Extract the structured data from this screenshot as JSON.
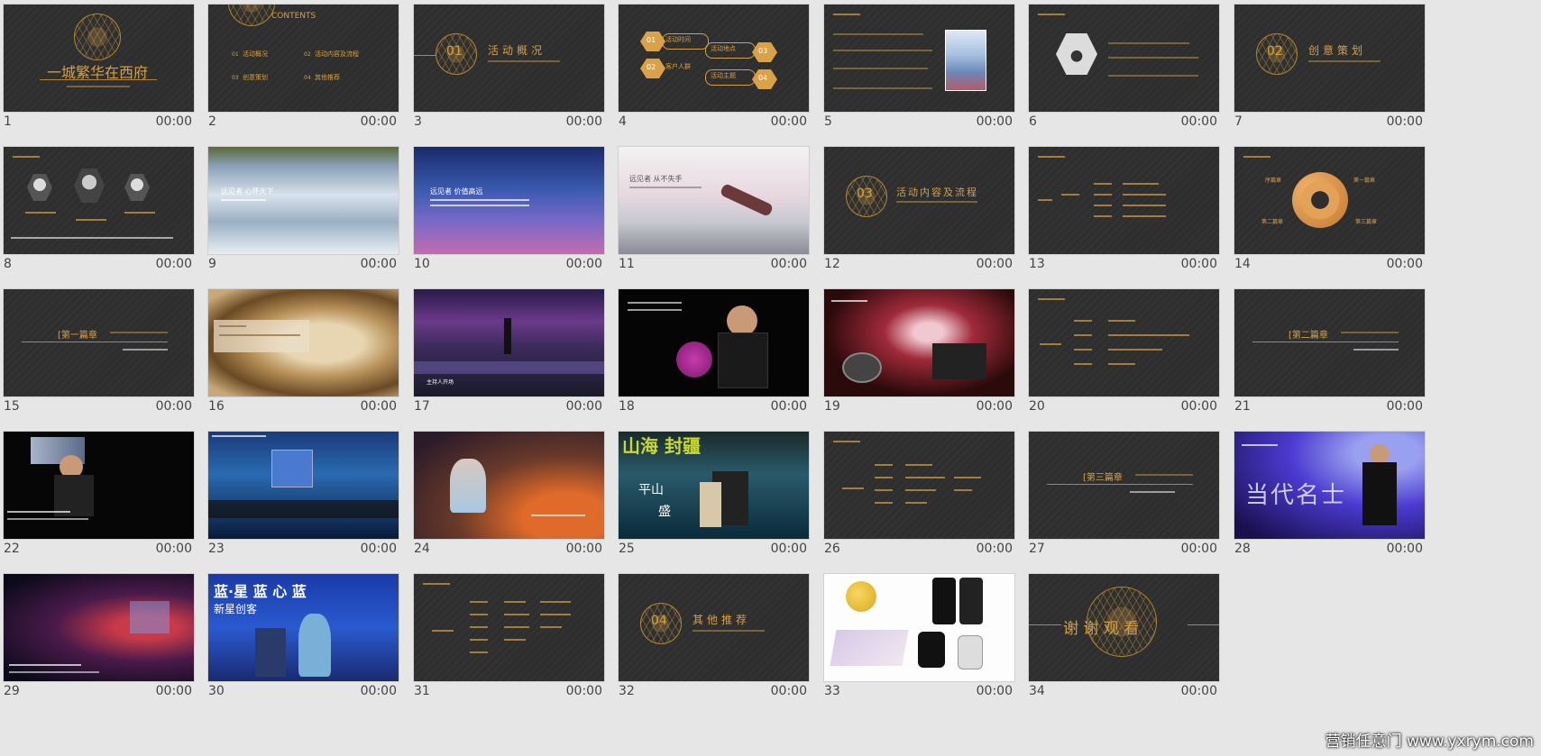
{
  "slides": [
    {
      "n": "1",
      "t": "00:00",
      "title": "一城繁华在西府"
    },
    {
      "n": "2",
      "t": "00:00",
      "title": "CONTENTS",
      "items": [
        "活动概况",
        "活动内容及流程",
        "创意策划",
        "其他推荐"
      ],
      "nums": [
        "01",
        "02",
        "03",
        "04"
      ]
    },
    {
      "n": "3",
      "t": "00:00",
      "num": "01",
      "title": "活动概况"
    },
    {
      "n": "4",
      "t": "00:00",
      "labels": [
        "活动时间",
        "活动地点",
        "客户人群",
        "活动主题"
      ],
      "nums": [
        "01",
        "02",
        "03",
        "04"
      ]
    },
    {
      "n": "5",
      "t": "00:00"
    },
    {
      "n": "6",
      "t": "00:00"
    },
    {
      "n": "7",
      "t": "00:00",
      "num": "02",
      "title": "创意策划"
    },
    {
      "n": "8",
      "t": "00:00"
    },
    {
      "n": "9",
      "t": "00:00",
      "title": "远见者 心怀天下"
    },
    {
      "n": "10",
      "t": "00:00",
      "title": "远见者 价值高远"
    },
    {
      "n": "11",
      "t": "00:00",
      "title": "远见者 从不失手"
    },
    {
      "n": "12",
      "t": "00:00",
      "num": "03",
      "title": "活动内容及流程"
    },
    {
      "n": "13",
      "t": "00:00"
    },
    {
      "n": "14",
      "t": "00:00",
      "labels": [
        "序篇章",
        "第一篇章",
        "第二篇章",
        "第三篇章"
      ]
    },
    {
      "n": "15",
      "t": "00:00",
      "title": "[第一篇章"
    },
    {
      "n": "16",
      "t": "00:00"
    },
    {
      "n": "17",
      "t": "00:00",
      "title": "主持人开场"
    },
    {
      "n": "18",
      "t": "00:00"
    },
    {
      "n": "19",
      "t": "00:00"
    },
    {
      "n": "20",
      "t": "00:00"
    },
    {
      "n": "21",
      "t": "00:00",
      "title": "[第二篇章"
    },
    {
      "n": "22",
      "t": "00:00"
    },
    {
      "n": "23",
      "t": "00:00"
    },
    {
      "n": "24",
      "t": "00:00"
    },
    {
      "n": "25",
      "t": "00:00",
      "banner": "山海 封疆",
      "caption": "平山",
      "sub": "盛"
    },
    {
      "n": "26",
      "t": "00:00"
    },
    {
      "n": "27",
      "t": "00:00",
      "title": "[第三篇章"
    },
    {
      "n": "28",
      "t": "00:00",
      "title": "当代名士"
    },
    {
      "n": "29",
      "t": "00:00"
    },
    {
      "n": "30",
      "t": "00:00",
      "banner": "蓝·星 蓝 心 蓝",
      "sub": "新星创客"
    },
    {
      "n": "31",
      "t": "00:00"
    },
    {
      "n": "32",
      "t": "00:00",
      "num": "04",
      "title": "其他推荐"
    },
    {
      "n": "33",
      "t": "00:00"
    },
    {
      "n": "34",
      "t": "00:00",
      "title": "谢 谢 观 看"
    }
  ],
  "watermark": "营销任意门 www.yxrym.com"
}
